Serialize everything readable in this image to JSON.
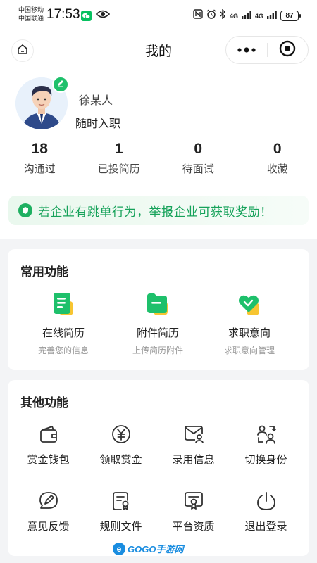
{
  "status_bar": {
    "carrier_1": "中国移动",
    "carrier_2": "中国联通",
    "time": "17:53",
    "signal_1": "4G",
    "signal_2": "4G",
    "battery": "87",
    "icons": [
      "wechat-icon",
      "eye-icon",
      "nfc-icon",
      "alarm-icon",
      "bluetooth-icon",
      "signal-icon",
      "signal-icon",
      "battery-icon"
    ]
  },
  "header": {
    "title": "我的",
    "icons": [
      "home-icon",
      "more-icon",
      "target-icon"
    ]
  },
  "profile": {
    "name": "徐某人",
    "status": "随时入职",
    "edit_icon": "pencil-icon"
  },
  "stats": [
    {
      "value": "18",
      "label": "沟通过"
    },
    {
      "value": "1",
      "label": "已投简历"
    },
    {
      "value": "0",
      "label": "待面试"
    },
    {
      "value": "0",
      "label": "收藏"
    }
  ],
  "banner": {
    "icon": "shield-icon",
    "text": "若企业有跳单行为，举报企业可获取奖励！"
  },
  "common_functions": {
    "title": "常用功能",
    "items": [
      {
        "title": "在线简历",
        "subtitle": "完善您的信息",
        "icon": "resume-icon"
      },
      {
        "title": "附件简历",
        "subtitle": "上传简历附件",
        "icon": "folder-icon"
      },
      {
        "title": "求职意向",
        "subtitle": "求职意向管理",
        "icon": "heart-icon"
      }
    ]
  },
  "other_functions": {
    "title": "其他功能",
    "items": [
      {
        "label": "赏金钱包",
        "icon": "wallet-icon"
      },
      {
        "label": "领取赏金",
        "icon": "yuan-icon"
      },
      {
        "label": "录用信息",
        "icon": "mail-user-icon"
      },
      {
        "label": "切换身份",
        "icon": "switch-user-icon"
      },
      {
        "label": "意见反馈",
        "icon": "feedback-icon"
      },
      {
        "label": "规则文件",
        "icon": "document-icon"
      },
      {
        "label": "平台资质",
        "icon": "certificate-icon"
      },
      {
        "label": "退出登录",
        "icon": "power-icon"
      }
    ]
  },
  "colors": {
    "accent_green": "#1ec06b",
    "banner_text": "#16a25a",
    "accent_yellow": "#f7c531",
    "page_bg": "#f3f4f6"
  },
  "watermark": {
    "text": "GOGO手游网"
  }
}
